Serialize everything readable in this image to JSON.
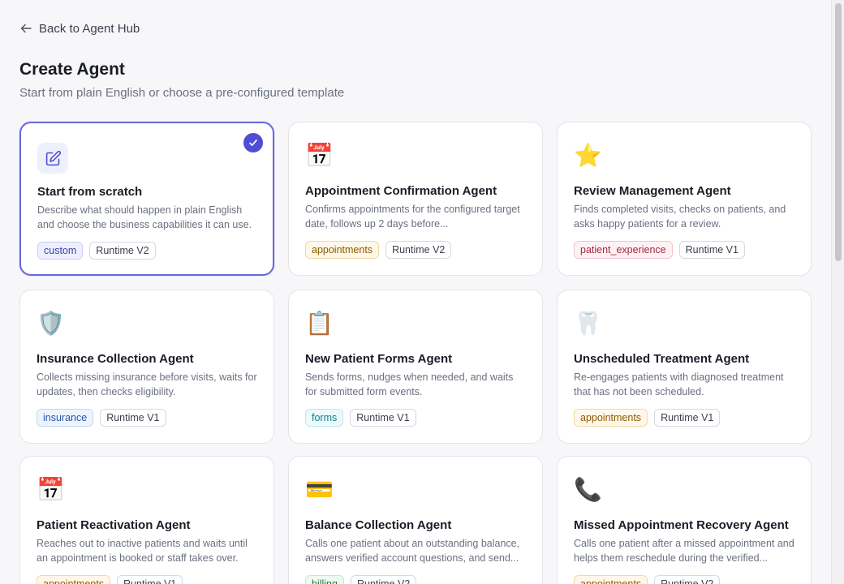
{
  "nav": {
    "back_label": "Back to Agent Hub"
  },
  "header": {
    "title": "Create Agent",
    "subtitle": "Start from plain English or choose a pre-configured template"
  },
  "cards": [
    {
      "id": "scratch",
      "icon": "pencil-square-icon",
      "title": "Start from scratch",
      "description": "Describe what should happen in plain English and choose the business capabilities it can use.",
      "tags": [
        {
          "label": "custom",
          "kind": "custom"
        },
        {
          "label": "Runtime V2",
          "kind": "runtime"
        }
      ],
      "selected": true
    },
    {
      "id": "appointment-confirmation",
      "icon": "calendar-icon",
      "emoji": "📅",
      "title": "Appointment Confirmation Agent",
      "description": "Confirms appointments for the configured target date, follows up 2 days before...",
      "tags": [
        {
          "label": "appointments",
          "kind": "appointments"
        },
        {
          "label": "Runtime V2",
          "kind": "runtime"
        }
      ],
      "selected": false
    },
    {
      "id": "review-management",
      "icon": "star-icon",
      "emoji": "⭐",
      "title": "Review Management Agent",
      "description": "Finds completed visits, checks on patients, and asks happy patients for a review.",
      "tags": [
        {
          "label": "patient_experience",
          "kind": "patient_experience"
        },
        {
          "label": "Runtime V1",
          "kind": "runtime"
        }
      ],
      "selected": false
    },
    {
      "id": "insurance-collection",
      "icon": "shield-icon",
      "emoji": "🛡️",
      "title": "Insurance Collection Agent",
      "description": "Collects missing insurance before visits, waits for updates, then checks eligibility.",
      "tags": [
        {
          "label": "insurance",
          "kind": "insurance"
        },
        {
          "label": "Runtime V1",
          "kind": "runtime"
        }
      ],
      "selected": false
    },
    {
      "id": "new-patient-forms",
      "icon": "clipboard-icon",
      "emoji": "📋",
      "title": "New Patient Forms Agent",
      "description": "Sends forms, nudges when needed, and waits for submitted form events.",
      "tags": [
        {
          "label": "forms",
          "kind": "forms"
        },
        {
          "label": "Runtime V1",
          "kind": "runtime"
        }
      ],
      "selected": false
    },
    {
      "id": "unscheduled-treatment",
      "icon": "tooth-icon",
      "emoji": "🦷",
      "title": "Unscheduled Treatment Agent",
      "description": "Re-engages patients with diagnosed treatment that has not been scheduled.",
      "tags": [
        {
          "label": "appointments",
          "kind": "appointments"
        },
        {
          "label": "Runtime V1",
          "kind": "runtime"
        }
      ],
      "selected": false
    },
    {
      "id": "patient-reactivation",
      "icon": "calendar-icon",
      "emoji": "📅",
      "title": "Patient Reactivation Agent",
      "description": "Reaches out to inactive patients and waits until an appointment is booked or staff takes over.",
      "tags": [
        {
          "label": "appointments",
          "kind": "appointments"
        },
        {
          "label": "Runtime V1",
          "kind": "runtime"
        }
      ],
      "selected": false
    },
    {
      "id": "balance-collection",
      "icon": "credit-card-icon",
      "emoji": "💳",
      "title": "Balance Collection Agent",
      "description": "Calls one patient about an outstanding balance, answers verified account questions, and send...",
      "tags": [
        {
          "label": "billing",
          "kind": "billing"
        },
        {
          "label": "Runtime V2",
          "kind": "runtime"
        }
      ],
      "selected": false
    },
    {
      "id": "missed-appointment-recovery",
      "icon": "phone-icon",
      "emoji": "📞",
      "title": "Missed Appointment Recovery Agent",
      "description": "Calls one patient after a missed appointment and helps them reschedule during the verified...",
      "tags": [
        {
          "label": "appointments",
          "kind": "appointments"
        },
        {
          "label": "Runtime V2",
          "kind": "runtime"
        }
      ],
      "selected": false
    }
  ]
}
